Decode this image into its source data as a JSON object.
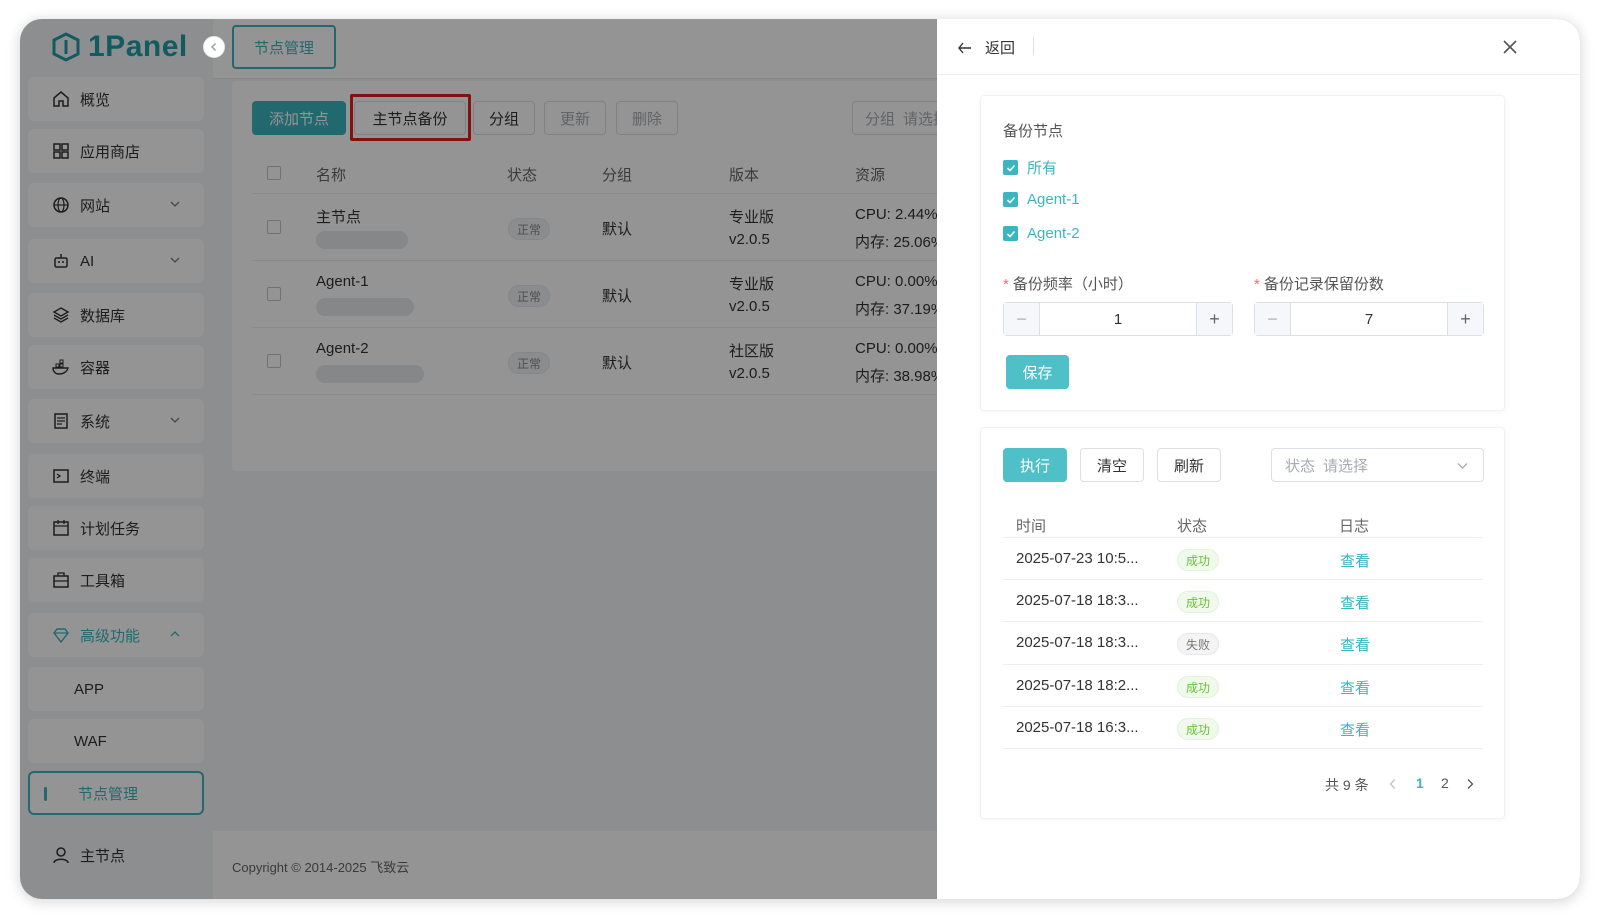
{
  "app": {
    "logo_text": "1Panel"
  },
  "sidebar": {
    "items": [
      {
        "label": "概览",
        "icon": "home-icon"
      },
      {
        "label": "应用商店",
        "icon": "grid-icon"
      },
      {
        "label": "网站",
        "icon": "globe-icon"
      },
      {
        "label": "AI",
        "icon": "robot-icon"
      },
      {
        "label": "数据库",
        "icon": "layers-icon"
      },
      {
        "label": "容器",
        "icon": "docker-icon"
      },
      {
        "label": "系统",
        "icon": "server-icon"
      },
      {
        "label": "终端",
        "icon": "terminal-icon"
      },
      {
        "label": "计划任务",
        "icon": "calendar-icon"
      },
      {
        "label": "工具箱",
        "icon": "toolbox-icon"
      },
      {
        "label": "高级功能",
        "icon": "diamond-icon"
      },
      {
        "label": "APP"
      },
      {
        "label": "WAF"
      },
      {
        "label": "节点管理"
      }
    ],
    "user": "主节点"
  },
  "page": {
    "tab": "节点管理",
    "toolbar": {
      "add": "添加节点",
      "backup": "主节点备份",
      "group": "分组",
      "update": "更新",
      "delete": "删除",
      "group_filter_label": "分组",
      "group_filter_placeholder": "请选择"
    },
    "columns": [
      "名称",
      "状态",
      "分组",
      "版本",
      "资源"
    ],
    "rows": [
      {
        "name": "主节点",
        "status": "正常",
        "group": "默认",
        "edition": "专业版",
        "version": "v2.0.5",
        "cpu": "CPU: 2.44%",
        "mem": "内存: 25.06%"
      },
      {
        "name": "Agent-1",
        "status": "正常",
        "group": "默认",
        "edition": "专业版",
        "version": "v2.0.5",
        "cpu": "CPU: 0.00%",
        "mem": "内存: 37.19%"
      },
      {
        "name": "Agent-2",
        "status": "正常",
        "group": "默认",
        "edition": "社区版",
        "version": "v2.0.5",
        "cpu": "CPU: 0.00%",
        "mem": "内存: 38.98%"
      }
    ],
    "footer": "Copyright © 2014-2025 飞致云"
  },
  "drawer": {
    "back": "返回",
    "backup_nodes_label": "备份节点",
    "nodes": [
      "所有",
      "Agent-1",
      "Agent-2"
    ],
    "frequency_label": "备份频率（小时）",
    "frequency_value": "1",
    "retention_label": "备份记录保留份数",
    "retention_value": "7",
    "save": "保存",
    "actions": {
      "run": "执行",
      "clear": "清空",
      "refresh": "刷新"
    },
    "status_filter_label": "状态",
    "status_filter_placeholder": "请选择",
    "log_columns": [
      "时间",
      "状态",
      "日志"
    ],
    "logs": [
      {
        "time": "2025-07-23 10:5...",
        "status": "成功",
        "link": "查看"
      },
      {
        "time": "2025-07-18 18:3...",
        "status": "成功",
        "link": "查看"
      },
      {
        "time": "2025-07-18 18:3...",
        "status": "失败",
        "link": "查看"
      },
      {
        "time": "2025-07-18 18:2...",
        "status": "成功",
        "link": "查看"
      },
      {
        "time": "2025-07-18 16:3...",
        "status": "成功",
        "link": "查看"
      }
    ],
    "pagination": {
      "total": "共 9 条",
      "pages": [
        "1",
        "2"
      ],
      "current": "1"
    }
  },
  "colors": {
    "accent": "#3bb5bf",
    "highlight": "#e02020",
    "success": "#67c23a"
  }
}
